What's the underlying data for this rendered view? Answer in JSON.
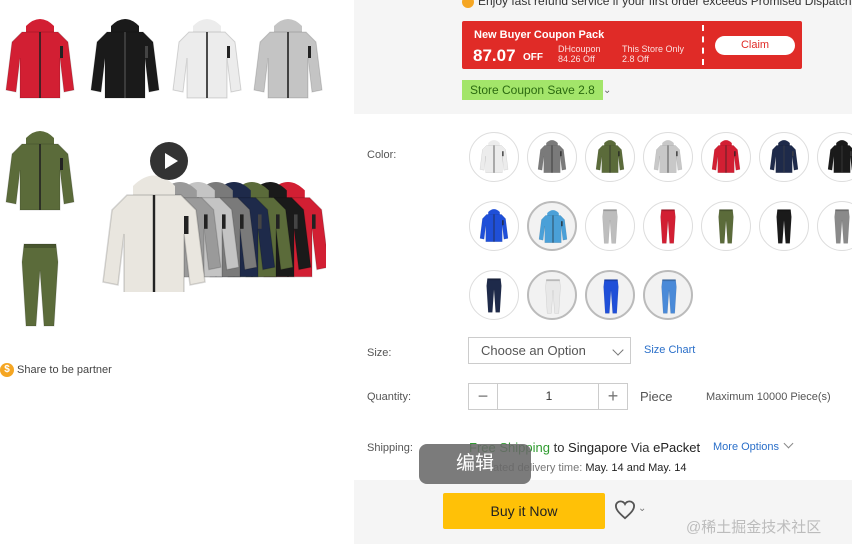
{
  "notice": "Enjoy fast refund service if your first order exceeds Promised Dispatch Da",
  "coupon": {
    "title": "New Buyer Coupon Pack",
    "amount": "87.07",
    "off": "OFF",
    "dh_label": "DHcoupon",
    "dh_value": "84.26 Off",
    "store_label": "This Store Only",
    "store_value": "2.8 Off",
    "claim": "Claim"
  },
  "store_coupon": "Store Coupon Save 2.8",
  "share": "Share to be partner",
  "labels": {
    "color": "Color:",
    "size": "Size:",
    "quantity": "Quantity:",
    "shipping": "Shipping:"
  },
  "size": {
    "placeholder": "Choose an Option",
    "chart_link": "Size Chart"
  },
  "quantity": {
    "value": "1",
    "unit": "Piece",
    "max": "Maximum 10000 Piece(s)",
    "minus": "−",
    "plus": "+"
  },
  "shipping": {
    "free": "Free Shipping",
    "to": "to",
    "country": "Singapore",
    "via": "Via",
    "carrier": "ePacket",
    "more": "More Options",
    "delivery_prefix": "ated delivery time:",
    "date_from": "May. 14",
    "and": "and",
    "date_to": "May. 14"
  },
  "buy_button": "Buy it Now",
  "overlay_edit": "编辑",
  "watermark": "@稀土掘金技术社区",
  "colors": {
    "accent_red": "#e02b27",
    "buy_yellow": "#ffc107",
    "link_blue": "#2a6fc9",
    "free_green": "#2e9b2e",
    "store_coupon_green": "#a3e56a"
  },
  "color_swatches": [
    {
      "name": "white-jacket",
      "color": "#ececec",
      "type": "jacket"
    },
    {
      "name": "gray-jacket",
      "color": "#7a7a7a",
      "type": "jacket"
    },
    {
      "name": "olive-jacket",
      "color": "#5b6b3a",
      "type": "jacket"
    },
    {
      "name": "light-gray-jacket",
      "color": "#c8c8c8",
      "type": "jacket"
    },
    {
      "name": "red-jacket",
      "color": "#d21f33",
      "type": "jacket"
    },
    {
      "name": "navy-jacket",
      "color": "#1e2a4a",
      "type": "jacket"
    },
    {
      "name": "black-jacket",
      "color": "#1a1a1a",
      "type": "jacket"
    },
    {
      "name": "royal-blue-jacket",
      "color": "#1f4fd8",
      "type": "jacket"
    },
    {
      "name": "sky-blue-jacket",
      "color": "#4aa0d8",
      "type": "jacket"
    },
    {
      "name": "light-gray-pants",
      "color": "#bdbdbd",
      "type": "pants"
    },
    {
      "name": "red-pants",
      "color": "#d21f33",
      "type": "pants"
    },
    {
      "name": "olive-pants",
      "color": "#5b6b3a",
      "type": "pants"
    },
    {
      "name": "black-pants",
      "color": "#1a1a1a",
      "type": "pants"
    },
    {
      "name": "gray-pants",
      "color": "#8a8a8a",
      "type": "pants"
    },
    {
      "name": "navy-pants",
      "color": "#1e2a4a",
      "type": "pants"
    },
    {
      "name": "white-pants",
      "color": "#e8e8e8",
      "type": "pants"
    },
    {
      "name": "royal-blue-pants",
      "color": "#1f4fd8",
      "type": "pants"
    },
    {
      "name": "sky-blue-pants",
      "color": "#4a8ad8",
      "type": "pants"
    }
  ],
  "gallery_thumbs": [
    {
      "name": "red-jacket",
      "color": "#d21f33",
      "type": "jacket"
    },
    {
      "name": "black-jacket",
      "color": "#1a1a1a",
      "type": "jacket"
    },
    {
      "name": "white-jacket",
      "color": "#ececec",
      "type": "jacket"
    },
    {
      "name": "light-gray-jacket",
      "color": "#c4c4c4",
      "type": "jacket"
    },
    {
      "name": "olive-jacket",
      "color": "#5b6b3a",
      "type": "jacket"
    },
    {
      "name": "olive-pants",
      "color": "#5b6b3a",
      "type": "pants"
    }
  ],
  "main_image_colors": [
    "#d21f33",
    "#1a1a1a",
    "#5b6b3a",
    "#1e2a4a",
    "#7a7a7a",
    "#c4c4c4",
    "#9a9a9a",
    "#e9e6df"
  ]
}
